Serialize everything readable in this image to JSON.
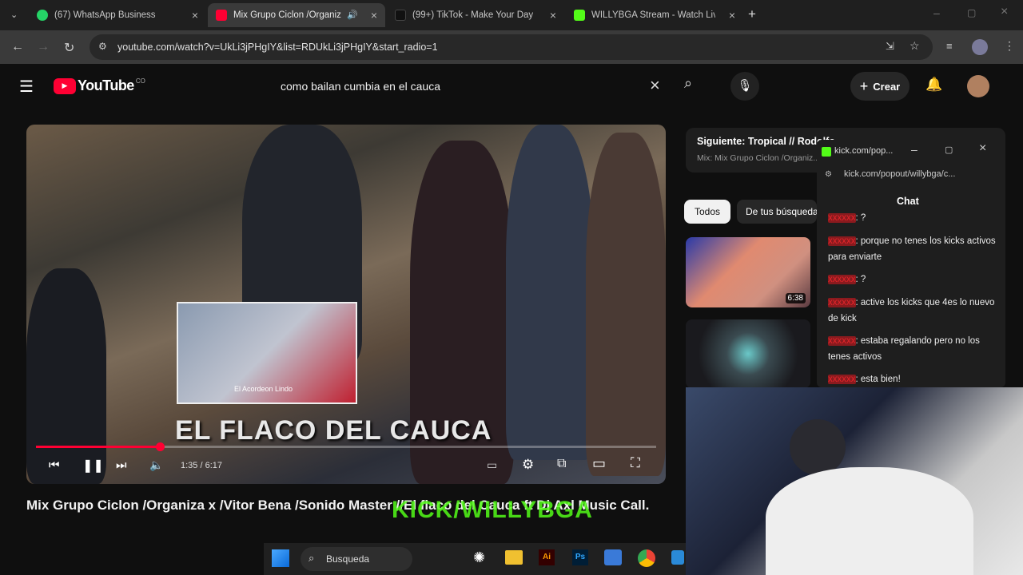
{
  "tabs": [
    {
      "label": "(67) WhatsApp Business",
      "color": "#25d366"
    },
    {
      "label": "Mix Grupo Ciclon /Organiz",
      "color": "#ff0033"
    },
    {
      "label": "(99+) TikTok - Make Your Day",
      "color": "#111111"
    },
    {
      "label": "WILLYBGA Stream - Watch Live",
      "color": "#53fc18"
    }
  ],
  "address": {
    "url": "youtube.com/watch?v=UkLi3jPHgIY&list=RDUkLi3jPHgIY&start_radio=1"
  },
  "youtube": {
    "logo": "YouTube",
    "country": "CO",
    "search_query": "como bailan cumbia en el cauca",
    "create_label": "Crear"
  },
  "player": {
    "overlay_title": "EL FLACO DEL CAUCA",
    "time": "1:35 / 6:17",
    "progress": 0.2,
    "inset_caption": "El Acordeon Lindo"
  },
  "video_title": "Mix Grupo Ciclon /Organiza x /Vitor Bena /Sonido Master //El flaco del Cauca ft Dj Axl Music Call.",
  "next": {
    "label": "Siguiente: Tropical // Rodolfo...",
    "sub": "Mix: Mix Grupo Ciclon /Organiz..."
  },
  "chips": {
    "all": "Todos",
    "yours": "De tus búsquedas"
  },
  "thumbs": [
    {
      "duration": "6:38"
    }
  ],
  "kick_popup": {
    "title": "kick.com/pop...",
    "url": "kick.com/popout/willybga/c...",
    "chat_header": "Chat",
    "messages": [
      {
        "user": "xxxxxx",
        "text": ": ?"
      },
      {
        "user": "xxxxxx",
        "text": ": porque no tenes los kicks activos para enviarte"
      },
      {
        "user": "xxxxxx",
        "text": ": ?"
      },
      {
        "user": "xxxxxx",
        "text": ": active los kicks que 4es lo nuevo de kick"
      },
      {
        "user": "xxxxxx",
        "text": ": estaba regalando pero no los tenes activos"
      },
      {
        "user": "xxxxxx",
        "text": ": esta bien!"
      }
    ]
  },
  "watermark": "KICK/WILLYBGA",
  "taskbar": {
    "search_label": "Busqueda"
  }
}
